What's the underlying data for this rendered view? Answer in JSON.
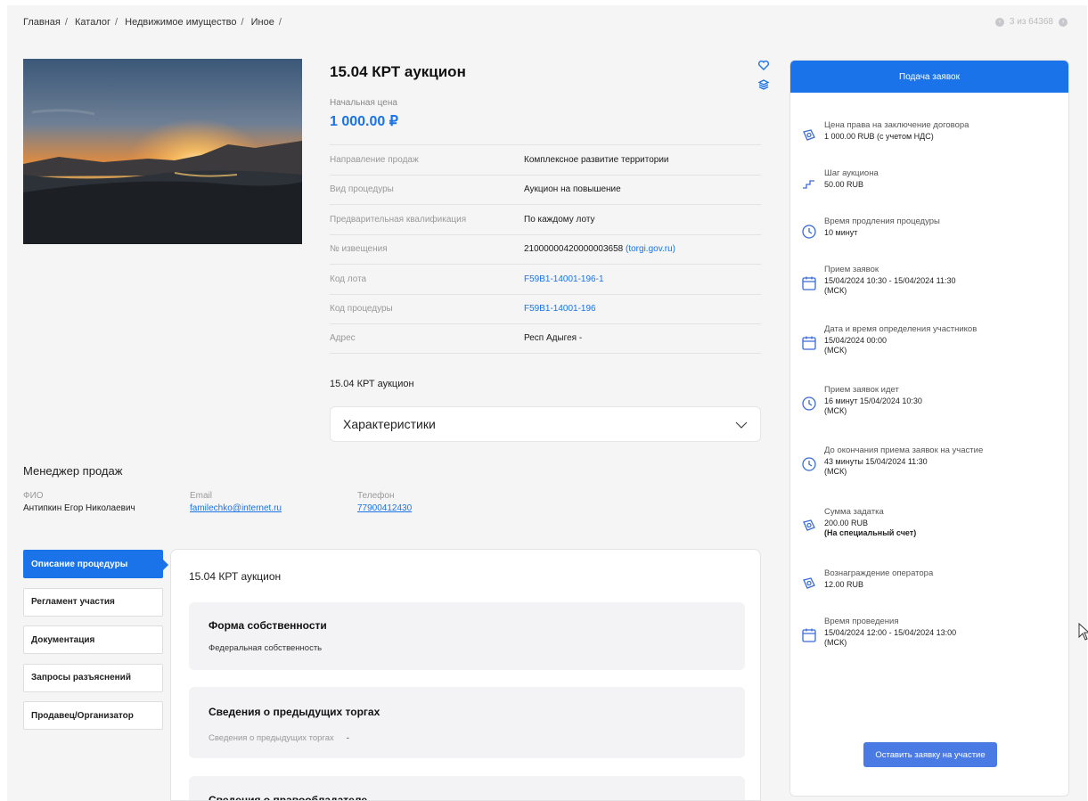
{
  "breadcrumb": [
    "Главная",
    "Каталог",
    "Недвижимое имущество",
    "Иное"
  ],
  "breadcrumb_sep": "/",
  "pager": {
    "text": "3 из 64368"
  },
  "lot": {
    "title": "15.04 КРТ аукцион",
    "price_label": "Начальная цена",
    "price_value": "1 000.00 ₽",
    "subtitle": "15.04 КРТ аукцион"
  },
  "props": [
    {
      "k": "Направление продаж",
      "v": "Комплексное развитие территории"
    },
    {
      "k": "Вид процедуры",
      "v": "Аукцион на повышение"
    },
    {
      "k": "Предварительная квалификация",
      "v": "По каждому лоту"
    },
    {
      "k": "№ извещения",
      "v": "21000000420000003658",
      "link": "(torgi.gov.ru)"
    },
    {
      "k": "Код лота",
      "v": "F59B1-14001-196-1"
    },
    {
      "k": "Код процедуры",
      "v": "F59B1-14001-196"
    },
    {
      "k": "Адрес",
      "v": "Респ Адыгея -"
    }
  ],
  "accordion": {
    "label": "Характеристики"
  },
  "manager": {
    "title": "Менеджер продаж",
    "fio_label": "ФИО",
    "fio": "Антипкин Егор Николаевич",
    "email_label": "Email",
    "email": "familechko@internet.ru",
    "phone_label": "Телефон",
    "phone": "77900412430"
  },
  "tabs": [
    "Описание процедуры",
    "Регламент участия",
    "Документация",
    "Запросы разъяснений",
    "Продавец/Организатор"
  ],
  "description": {
    "title": "15.04 КРТ аукцион",
    "cards": [
      {
        "heading": "Форма собственности",
        "text": "Федеральная собственность"
      },
      {
        "heading": "Сведения о предыдущих торгах",
        "label": "Сведения о предыдущих торгах",
        "text": "-"
      },
      {
        "heading": "Сведения о правообладателе"
      }
    ]
  },
  "right_panel": {
    "header": "Подача заявок",
    "items": [
      {
        "icon": "money-icon",
        "label": "Цена права на заключение договора",
        "value": "1 000.00 RUB (с учетом НДС)"
      },
      {
        "icon": "steps-icon",
        "label": "Шаг аукциона",
        "value": "50.00 RUB"
      },
      {
        "icon": "clock-icon",
        "label": "Время продления процедуры",
        "value": "10 минут"
      },
      {
        "icon": "calendar-icon",
        "label": "Прием заявок",
        "value": "15/04/2024 10:30  - 15/04/2024 11:30",
        "value2": "(МСК)"
      },
      {
        "icon": "calendar-icon",
        "label": "Дата и время определения участников",
        "value": "15/04/2024 00:00",
        "value2": "(МСК)"
      },
      {
        "icon": "clock-icon",
        "label": "Прием заявок идет",
        "value": "16 минут 15/04/2024 10:30",
        "value2": "(МСК)"
      },
      {
        "icon": "clock-icon",
        "label": "До окончания приема заявок на участие",
        "value": "43 минуты 15/04/2024 11:30",
        "value2": "(МСК)"
      },
      {
        "icon": "money-icon",
        "label": "Сумма задатка",
        "value": "200.00 RUB",
        "value2": "(На специальный счет)"
      },
      {
        "icon": "money-icon",
        "label": "Вознаграждение оператора",
        "value": "12.00 RUB"
      },
      {
        "icon": "calendar-icon",
        "label": "Время проведения",
        "value": "15/04/2024 12:00  - 15/04/2024 13:00",
        "value2": "(МСК)"
      }
    ],
    "button": "Оставить заявку на участие"
  },
  "colors": {
    "accent": "#1a73e8",
    "button": "#4a7be5",
    "background": "#f5f5f6"
  }
}
